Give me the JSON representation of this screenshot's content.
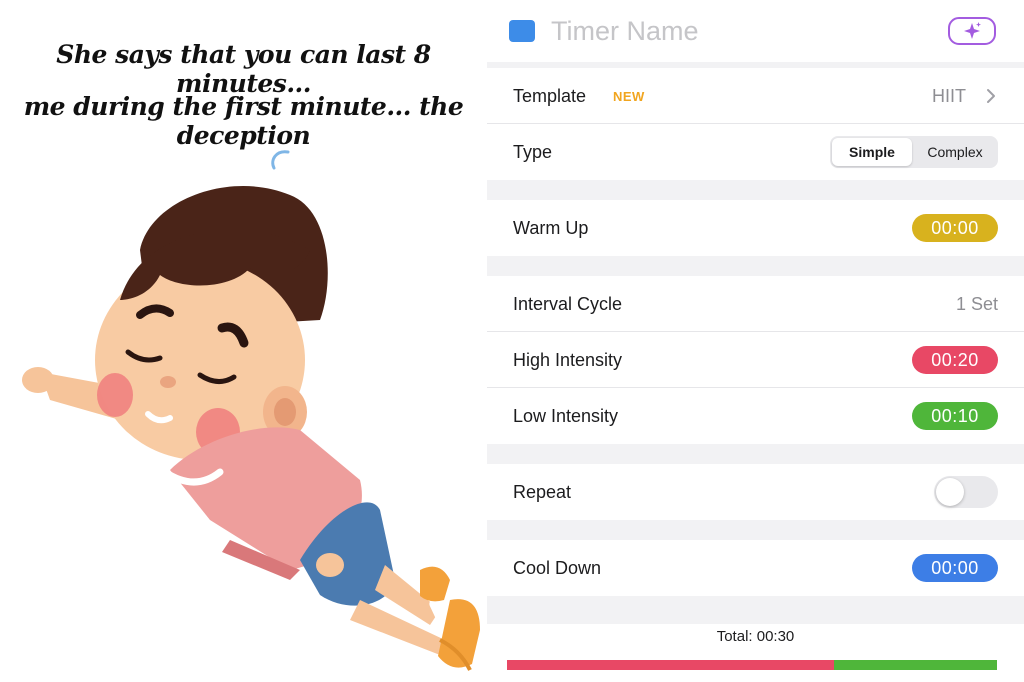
{
  "meme": {
    "caption_line1": "She says that you can last 8 minutes...",
    "caption_line2": "me during the first minute... the deception"
  },
  "app": {
    "header": {
      "name_placeholder": "Timer Name",
      "color_chip": "#3d8ce8",
      "magic_icon": "sparkles-icon"
    },
    "template": {
      "label": "Template",
      "badge": "NEW",
      "value": "HIIT"
    },
    "type": {
      "label": "Type",
      "options": [
        "Simple",
        "Complex"
      ],
      "selected": "Simple"
    },
    "warm_up": {
      "label": "Warm Up",
      "value": "00:00",
      "color": "#d8b21e"
    },
    "interval_cycle": {
      "label": "Interval Cycle",
      "value": "1 Set"
    },
    "high_intensity": {
      "label": "High Intensity",
      "value": "00:20",
      "color": "#e84865"
    },
    "low_intensity": {
      "label": "Low Intensity",
      "value": "00:10",
      "color": "#4fb63a"
    },
    "repeat": {
      "label": "Repeat",
      "enabled": false
    },
    "cool_down": {
      "label": "Cool Down",
      "value": "00:00",
      "color": "#3d7ee6"
    },
    "total": "Total: 00:30",
    "timeline": [
      {
        "name": "High Intensity",
        "seconds": 20,
        "color": "#e84865"
      },
      {
        "name": "Low Intensity",
        "seconds": 10,
        "color": "#4fb63a"
      }
    ]
  }
}
